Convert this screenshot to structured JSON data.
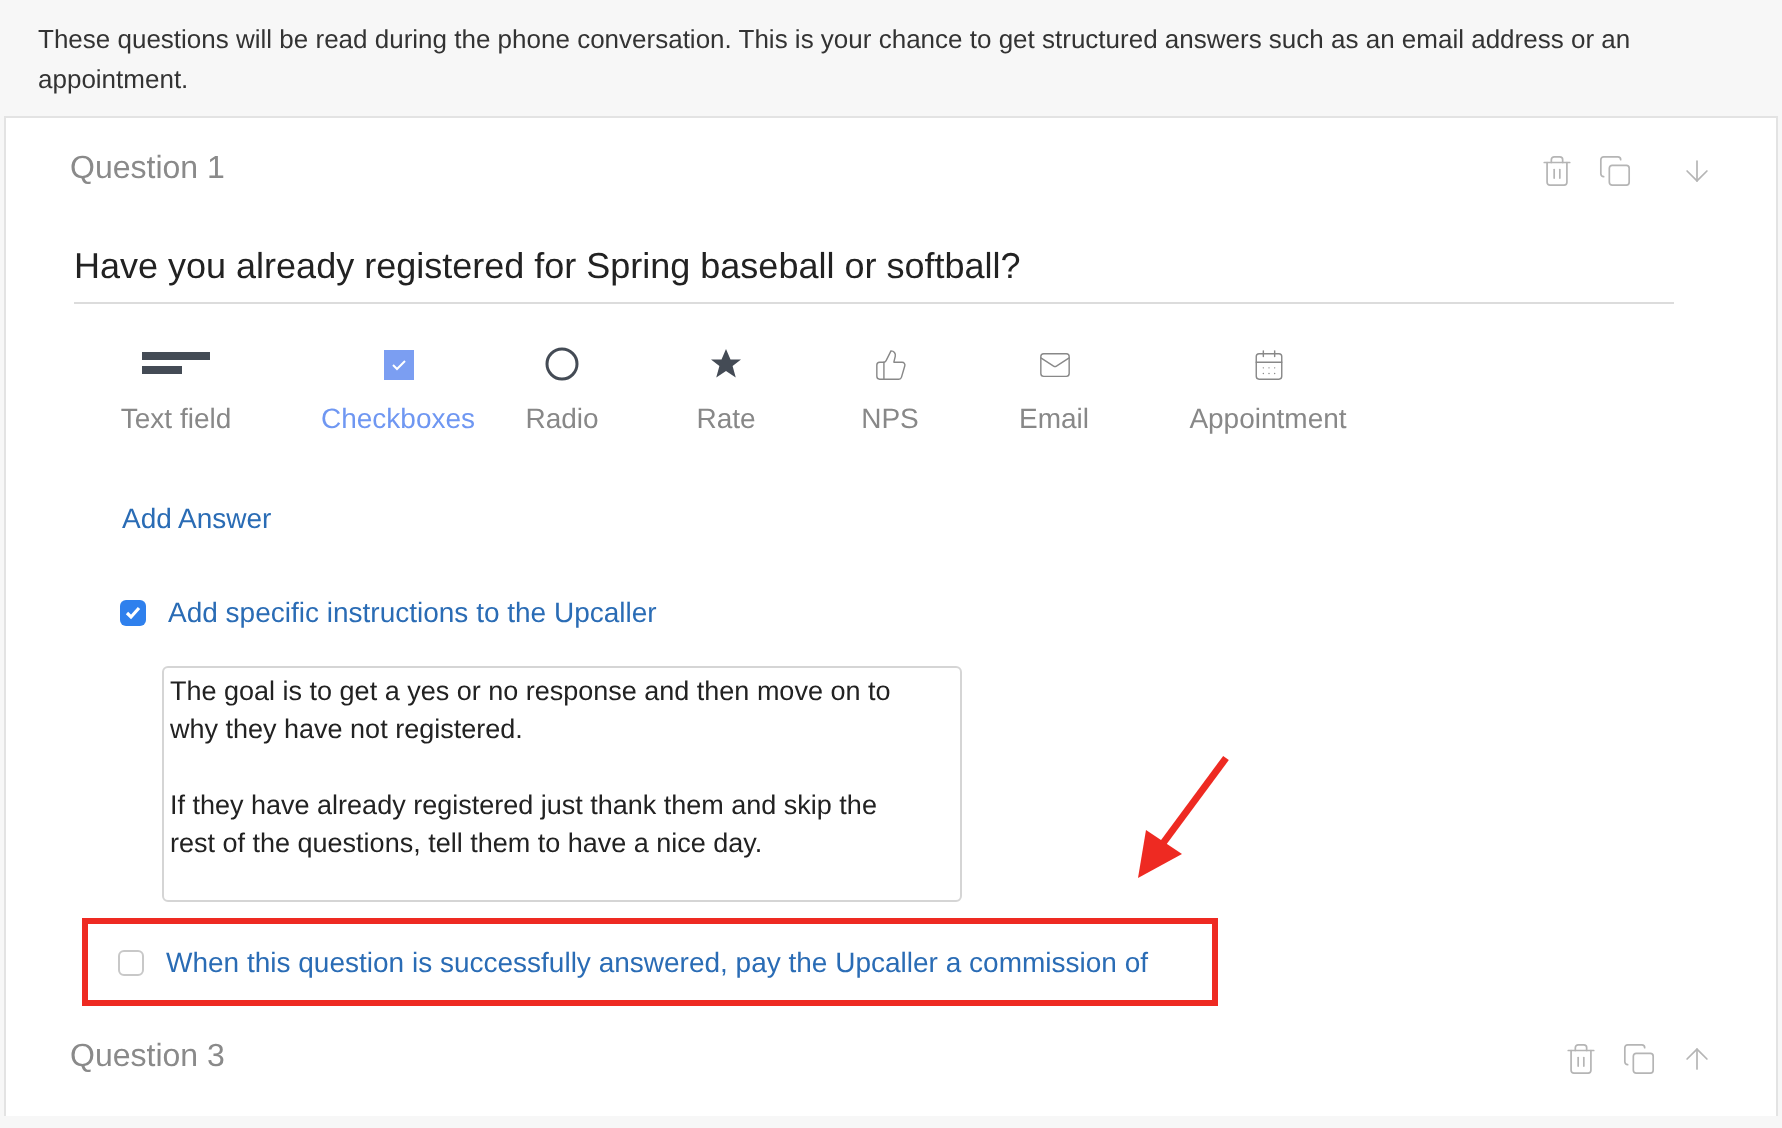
{
  "intro": "These questions will be read during the phone conversation. This is your chance to get structured answers such as an email address or an appointment.",
  "questions": [
    {
      "title": "Question 1",
      "text": "Have you already registered for Spring baseball or softball?",
      "actions": [
        {
          "kind": "delete"
        },
        {
          "kind": "duplicate"
        },
        {
          "kind": "move_down"
        }
      ],
      "types": [
        {
          "kind": "text",
          "label": "Text field",
          "selected": false
        },
        {
          "kind": "checkbox",
          "label": "Checkboxes",
          "selected": true
        },
        {
          "kind": "radio",
          "label": "Radio",
          "selected": false
        },
        {
          "kind": "rate",
          "label": "Rate",
          "selected": false
        },
        {
          "kind": "nps",
          "label": "NPS",
          "selected": false
        },
        {
          "kind": "email",
          "label": "Email",
          "selected": false
        },
        {
          "kind": "appointment",
          "label": "Appointment",
          "selected": false
        }
      ],
      "add_answer": "Add Answer",
      "instructions": {
        "checked": true,
        "label": "Add specific instructions to the Upcaller",
        "value": "The goal is to get a yes or no response and then move on to why they have not registered.\n\nIf they have already registered just thank them and skip the rest of the questions, tell them to have a nice day."
      },
      "commission": {
        "checked": false,
        "highlighted": true,
        "label": "When this question is successfully answered, pay the Upcaller a commission of"
      }
    },
    {
      "title": "Question 3",
      "actions": [
        {
          "kind": "delete"
        },
        {
          "kind": "duplicate"
        },
        {
          "kind": "move_up"
        }
      ]
    }
  ]
}
